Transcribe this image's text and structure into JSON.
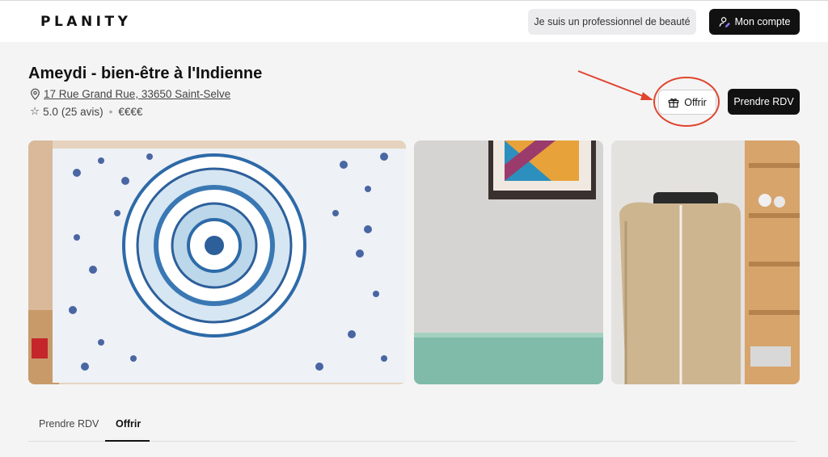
{
  "header": {
    "logo": "PLANITY",
    "pro_label": "Je suis un professionnel de beauté",
    "account_label": "Mon compte",
    "account_icon": "user-edit-icon"
  },
  "salon": {
    "name": "Ameydi - bien-être à l'Indienne",
    "address": "17 Rue Grand Rue, 33650 Saint-Selve",
    "rating": "5.0",
    "reviews": "(25 avis)",
    "price": "€€€€"
  },
  "actions": {
    "offrir_label": "Offrir",
    "offrir_icon": "gift-icon",
    "rdv_label": "Prendre RDV"
  },
  "photos": [
    {
      "subject": "mandala-tapestry"
    },
    {
      "subject": "painting-and-massage-table"
    },
    {
      "subject": "sauna-cabin-and-shelf"
    }
  ],
  "tabs": [
    {
      "label": "Prendre RDV",
      "active": false
    },
    {
      "label": "Offrir",
      "active": true
    }
  ],
  "colors": {
    "primary": "#111111",
    "background": "#f4f4f4",
    "annotation": "#e0442e"
  }
}
